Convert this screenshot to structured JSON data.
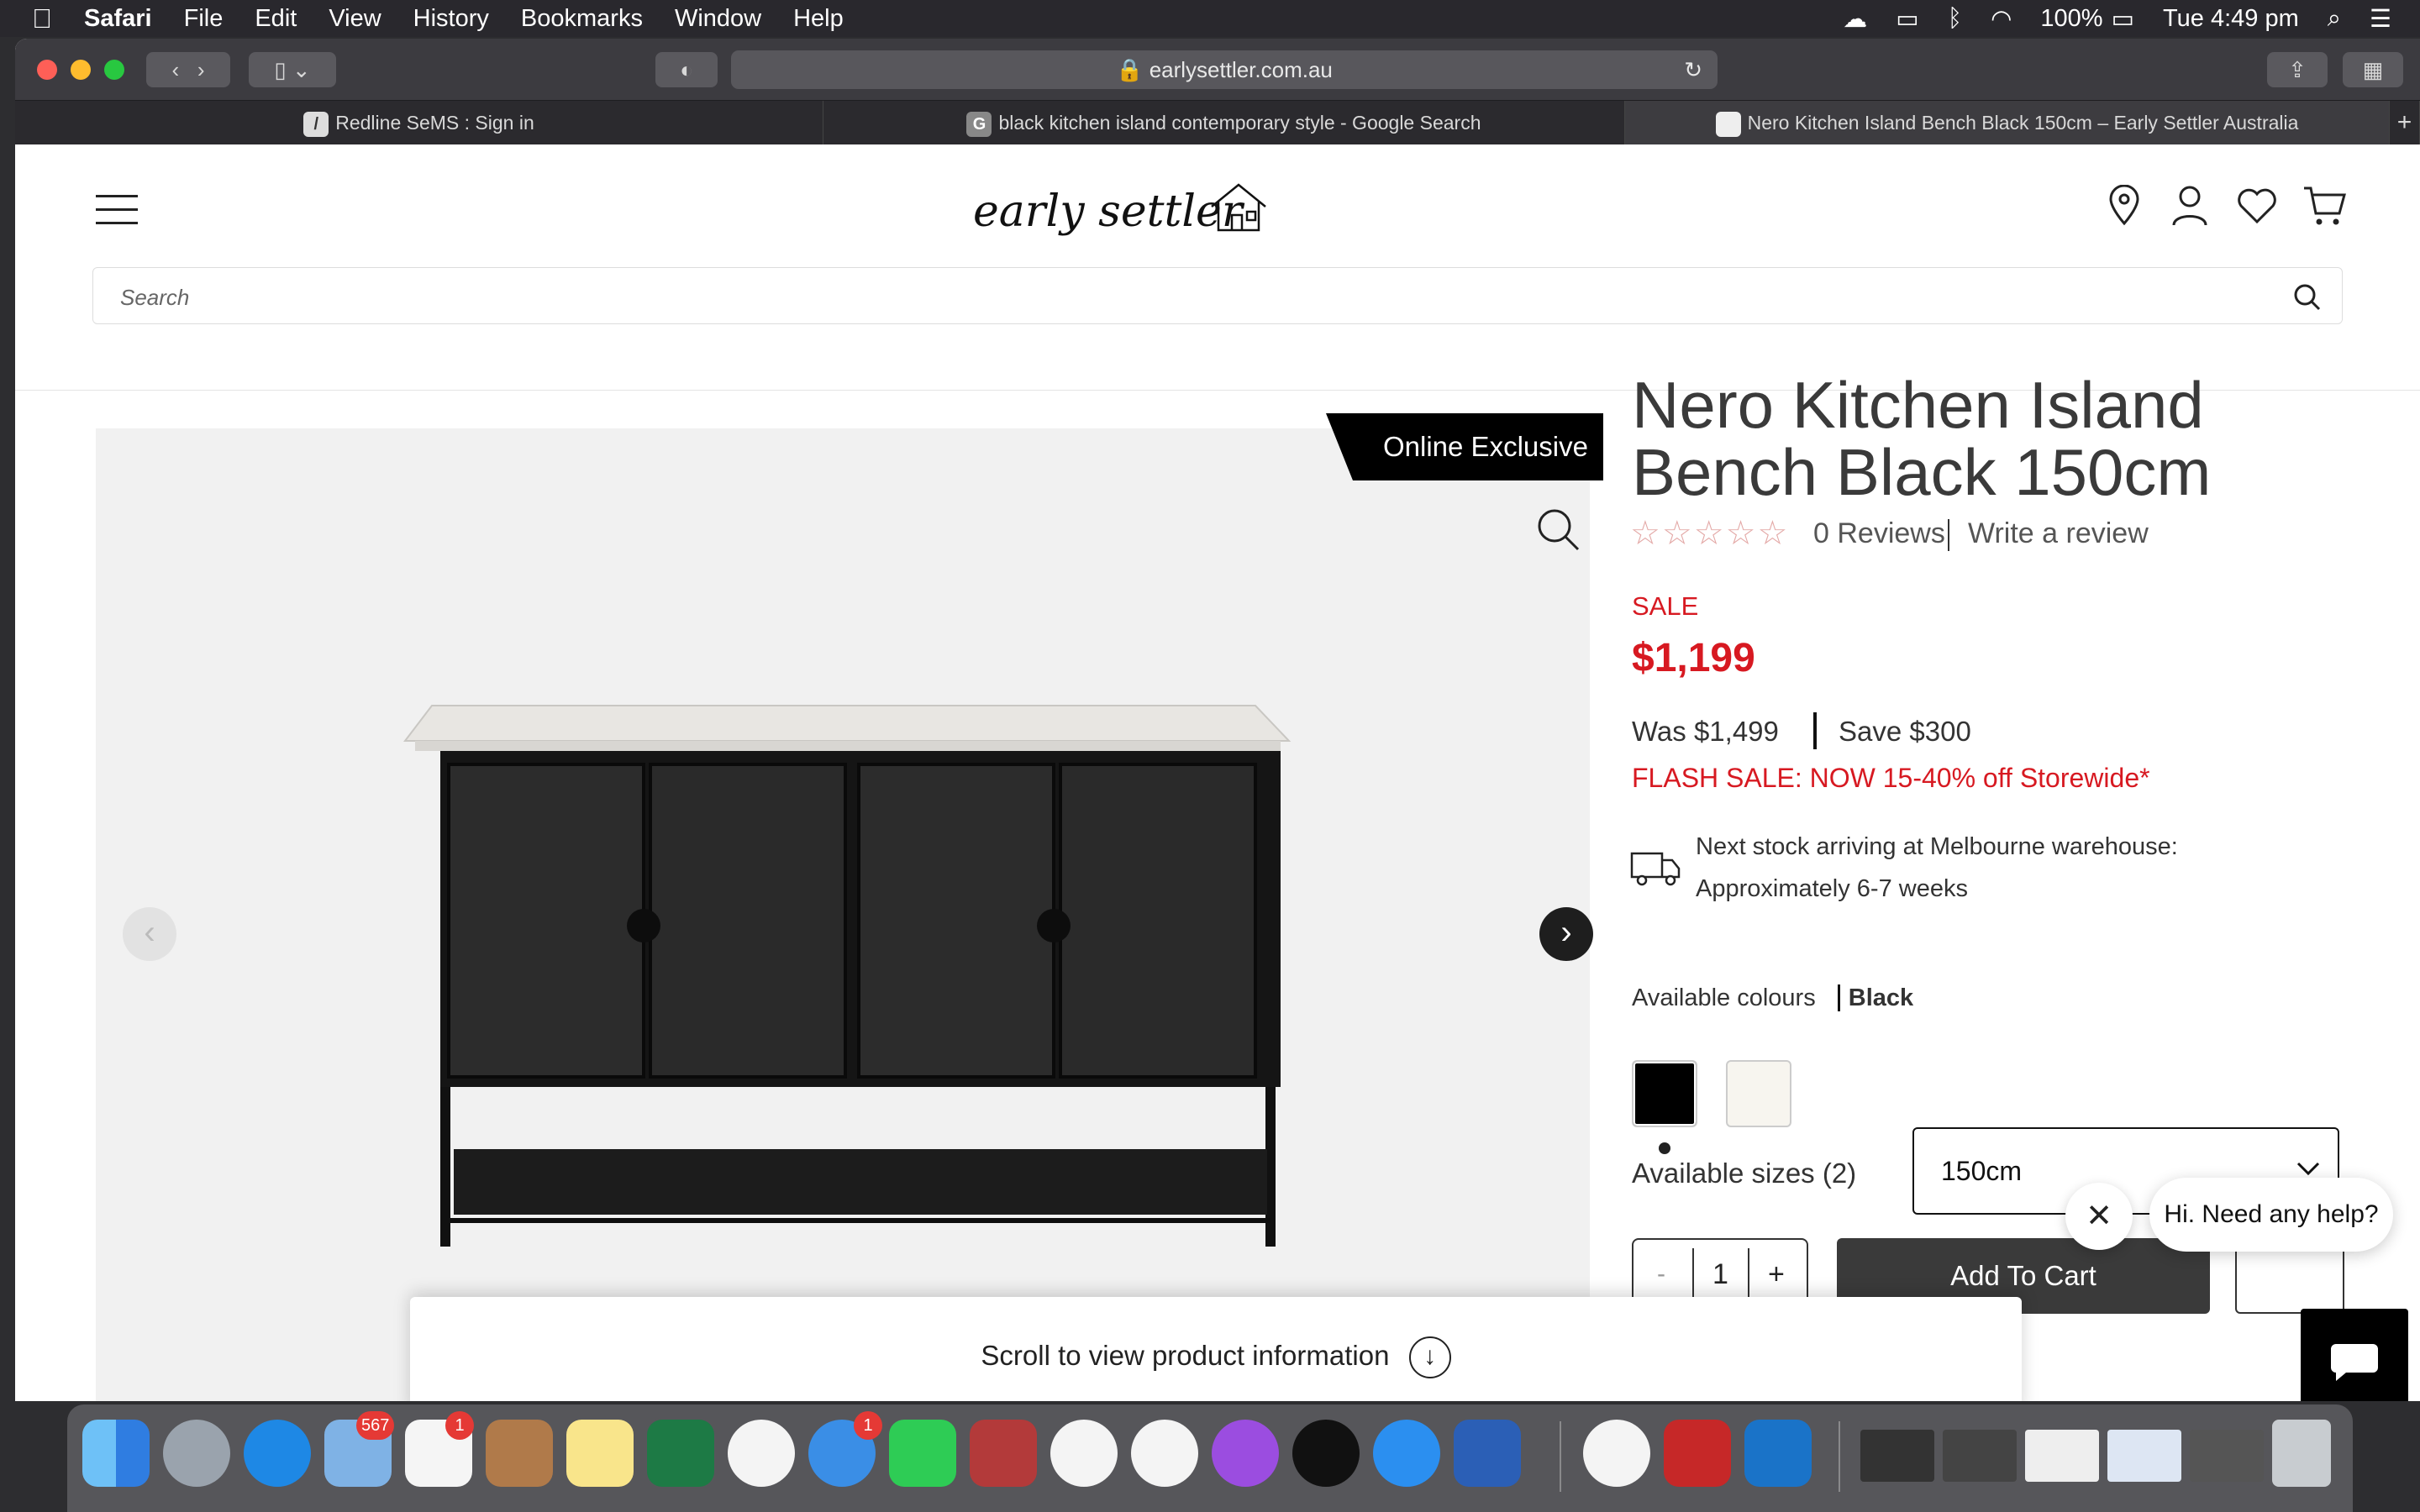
{
  "menubar": {
    "apple": "",
    "app": "Safari",
    "items": [
      "File",
      "Edit",
      "View",
      "History",
      "Bookmarks",
      "Window",
      "Help"
    ],
    "battery": "100%",
    "clock": "Tue 4:49 pm"
  },
  "browser": {
    "url": "earlysettler.com.au",
    "tabs": [
      {
        "label": "Redline SeMS : Sign in"
      },
      {
        "label": "black kitchen island contemporary style - Google Search"
      },
      {
        "label": "Nero Kitchen Island Bench Black 150cm – Early Settler Australia"
      }
    ]
  },
  "site": {
    "logo": "early settler",
    "search_placeholder": "Search"
  },
  "product": {
    "badge": "Online Exclusive",
    "title": "Nero Kitchen Island Bench Black 150cm",
    "stars": "☆☆☆☆☆",
    "reviews": "0 Reviews",
    "write_review": "Write a review",
    "sale_label": "SALE",
    "price": "$1,199",
    "was": "Was $1,499",
    "save": "Save $300",
    "flash": "FLASH SALE: NOW 15-40% off Storewide*",
    "stock_line1": "Next stock arriving at Melbourne warehouse:",
    "stock_line2": "Approximately 6-7 weeks",
    "colours_label": "Available colours",
    "colour_selected": "Black",
    "sizes_label": "Available sizes (2)",
    "size_value": "150cm",
    "qty_minus": "-",
    "qty_value": "1",
    "qty_plus": "+",
    "add_to_cart": "Add To Cart",
    "scroll_hint": "Scroll to view product information"
  },
  "chat": {
    "bubble": "Hi. Need any help?"
  },
  "dock": {
    "mail_badge": "567",
    "reminders_badge": "1",
    "messages_badge": "1"
  },
  "colors": {
    "sale_red": "#d71921",
    "cart_button": "#3a3a3a"
  }
}
